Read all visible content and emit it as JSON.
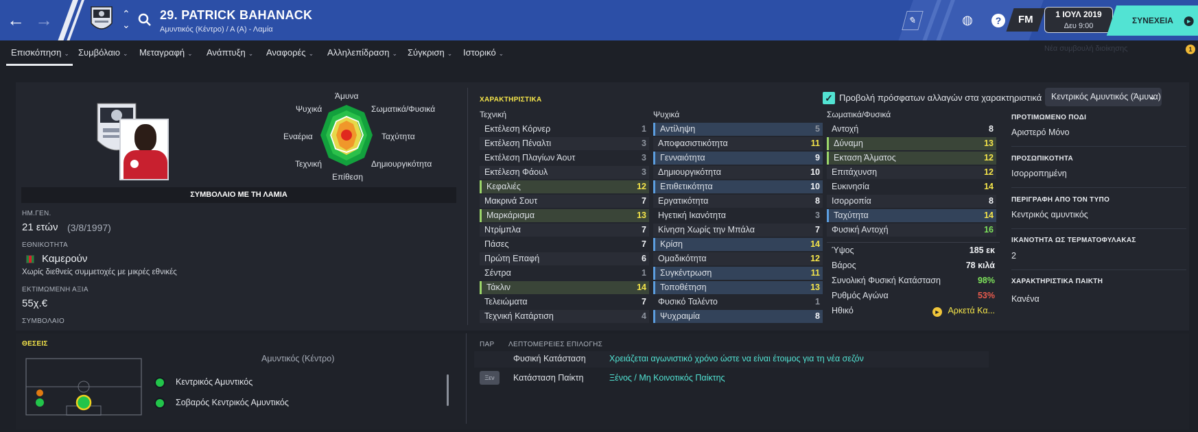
{
  "header": {
    "player_name": "29. PATRICK BAHANACK",
    "player_sub": "Αμυντικός (Κέντρο) / Α (Α) - Λαμία",
    "date_line1": "1 ΙΟΥΛ 2019",
    "date_line2": "Δευ 9:00",
    "fm": "FM",
    "continue": "ΣΥΝΕΧΕΙΑ",
    "help": "?"
  },
  "tabs": [
    "Επισκόπηση",
    "Συμβόλαιο",
    "Μεταγραφή",
    "Ανάπτυξη",
    "Αναφορές",
    "Αλληλεπίδραση",
    "Σύγκριση",
    "Ιστορικό"
  ],
  "new_message": "Νέα συμβουλή διοίκησης",
  "notification_count": "1",
  "radar": {
    "labels": {
      "top": "Άμυνα",
      "top_right": "Σωματικά/Φυσικά",
      "right": "Ταχύτητα",
      "bottom_right": "Δημιουργικότητα",
      "bottom": "Επίθεση",
      "bottom_left": "Τεχνική",
      "left": "Εναέρια",
      "top_left": "Ψυχικά"
    }
  },
  "contract_bar": "ΣΥΜΒΟΛΑΙΟ ΜΕ ΤΗ ΛΑΜΙΑ",
  "profile": {
    "dob_label": "ΗΜ.ΓΕΝ.",
    "age": "21 ετών",
    "dob": "(3/8/1997)",
    "nat_label": "ΕΘΝΙΚΟΤΗΤΑ",
    "nationality": "Καμερούν",
    "nat_note": "Χωρίς διεθνείς συμμετοχές με μικρές εθνικές",
    "value_label": "ΕΚΤΙΜΩΜΕΝΗ ΑΞΙΑ",
    "value": "55χ.€",
    "contract_label": "ΣΥΜΒΟΛΑΙΟ"
  },
  "attributes": {
    "title": "ΧΑΡΑΚΤΗΡΙΣΤΙΚΑ",
    "show_changes": "Προβολή πρόσφατων αλλαγών στα χαρακτηριστικά",
    "role_select": "Κεντρικός Αμυντικός (Άμυνα)",
    "technical_head": "Τεχνική",
    "mental_head": "Ψυχικά",
    "physical_head": "Σωματικά/Φυσικά",
    "technical": [
      {
        "name": "Εκτέλεση Κόρνερ",
        "value": "1",
        "hl": ""
      },
      {
        "name": "Εκτέλεση Πέναλτι",
        "value": "3",
        "hl": ""
      },
      {
        "name": "Εκτέλεση Πλαγίων Άουτ",
        "value": "3",
        "hl": ""
      },
      {
        "name": "Εκτέλεση Φάουλ",
        "value": "3",
        "hl": ""
      },
      {
        "name": "Κεφαλιές",
        "value": "12",
        "hl": "green"
      },
      {
        "name": "Μακρινά Σουτ",
        "value": "7",
        "hl": ""
      },
      {
        "name": "Μαρκάρισμα",
        "value": "13",
        "hl": "green"
      },
      {
        "name": "Ντρίμπλα",
        "value": "7",
        "hl": ""
      },
      {
        "name": "Πάσες",
        "value": "7",
        "hl": ""
      },
      {
        "name": "Πρώτη Επαφή",
        "value": "6",
        "hl": ""
      },
      {
        "name": "Σέντρα",
        "value": "1",
        "hl": ""
      },
      {
        "name": "Τάκλιν",
        "value": "14",
        "hl": "green"
      },
      {
        "name": "Τελειώματα",
        "value": "7",
        "hl": ""
      },
      {
        "name": "Τεχνική Κατάρτιση",
        "value": "4",
        "hl": ""
      }
    ],
    "mental": [
      {
        "name": "Αντίληψη",
        "value": "5",
        "hl": "blue"
      },
      {
        "name": "Αποφασιστικότητα",
        "value": "11",
        "hl": ""
      },
      {
        "name": "Γενναιότητα",
        "value": "9",
        "hl": "blue"
      },
      {
        "name": "Δημιουργικότητα",
        "value": "10",
        "hl": ""
      },
      {
        "name": "Επιθετικότητα",
        "value": "10",
        "hl": "blue"
      },
      {
        "name": "Εργατικότητα",
        "value": "8",
        "hl": ""
      },
      {
        "name": "Ηγετική Ικανότητα",
        "value": "3",
        "hl": ""
      },
      {
        "name": "Κίνηση Χωρίς την Μπάλα",
        "value": "7",
        "hl": ""
      },
      {
        "name": "Κρίση",
        "value": "14",
        "hl": "blue"
      },
      {
        "name": "Ομαδικότητα",
        "value": "12",
        "hl": ""
      },
      {
        "name": "Συγκέντρωση",
        "value": "11",
        "hl": "blue"
      },
      {
        "name": "Τοποθέτηση",
        "value": "13",
        "hl": "blue"
      },
      {
        "name": "Φυσικό Ταλέντο",
        "value": "1",
        "hl": ""
      },
      {
        "name": "Ψυχραιμία",
        "value": "8",
        "hl": "blue"
      }
    ],
    "physical": [
      {
        "name": "Αντοχή",
        "value": "8",
        "hl": ""
      },
      {
        "name": "Δύναμη",
        "value": "13",
        "hl": "green"
      },
      {
        "name": "Εκταση Άλματος",
        "value": "12",
        "hl": "green"
      },
      {
        "name": "Επιτάχυνση",
        "value": "12",
        "hl": ""
      },
      {
        "name": "Ευκινησία",
        "value": "14",
        "hl": ""
      },
      {
        "name": "Ισορροπία",
        "value": "8",
        "hl": ""
      },
      {
        "name": "Ταχύτητα",
        "value": "14",
        "hl": "blue"
      },
      {
        "name": "Φυσική Αντοχή",
        "value": "16",
        "hl": ""
      }
    ],
    "info": [
      {
        "label": "Ύψος",
        "value": "185 εκ"
      },
      {
        "label": "Βάρος",
        "value": "78 κιλά"
      },
      {
        "label": "Συνολική Φυσική Κατάσταση",
        "value": "98%"
      },
      {
        "label": "Ρυθμός Αγώνα",
        "value": "53%"
      },
      {
        "label": "Ηθικό",
        "value": "Αρκετά Κα..."
      }
    ]
  },
  "right": {
    "foot_title": "ΠΡΟΤΙΜΩΜΕΝΟ ΠΟΔΙ",
    "foot": "Αριστερό Μόνο",
    "personality_title": "ΠΡΟΣΩΠΙΚΟΤΗΤΑ",
    "personality": "Ισορροπημένη",
    "media_title": "ΠΕΡΙΓΡΑΦΗ ΑΠΟ ΤΟΝ ΤΥΠΟ",
    "media": "Κεντρικός αμυντικός",
    "gk_title": "ΙΚΑΝΟΤΗΤΑ ΩΣ ΤΕΡΜΑΤΟΦΥΛΑΚΑΣ",
    "gk": "2",
    "traits_title": "ΧΑΡΑΚΤΗΡΙΣΤΙΚΑ ΠΑΙΚΤΗ",
    "traits": "Κανένα"
  },
  "positions": {
    "title": "ΘΕΣΕΙΣ",
    "subtitle": "Αμυντικός (Κέντρο)",
    "roles": [
      "Κεντρικός Αμυντικός",
      "Σοβαρός Κεντρικός Αμυντικός"
    ]
  },
  "selection": {
    "col1": "ΠΑΡ",
    "col2": "ΛΕΠΤΟΜΕΡΕΙΕΣ ΕΠΙΛΟΓΗΣ",
    "rows": [
      {
        "badge": "",
        "label": "Φυσική Κατάσταση",
        "value": "Χρειάζεται αγωνιστικό χρόνο ώστε να είναι έτοιμος για τη νέα σεζόν"
      },
      {
        "badge": "Ξεν",
        "label": "Κατάσταση Παίκτη",
        "value": "Ξένος / Μη Κοινοτικός Παίκτης"
      }
    ]
  },
  "colors": {
    "header": "#2c4fa7",
    "accent": "#52e3d3",
    "yellow": "#f5e54a",
    "green": "#7ee35b",
    "red": "#e95b4d"
  }
}
